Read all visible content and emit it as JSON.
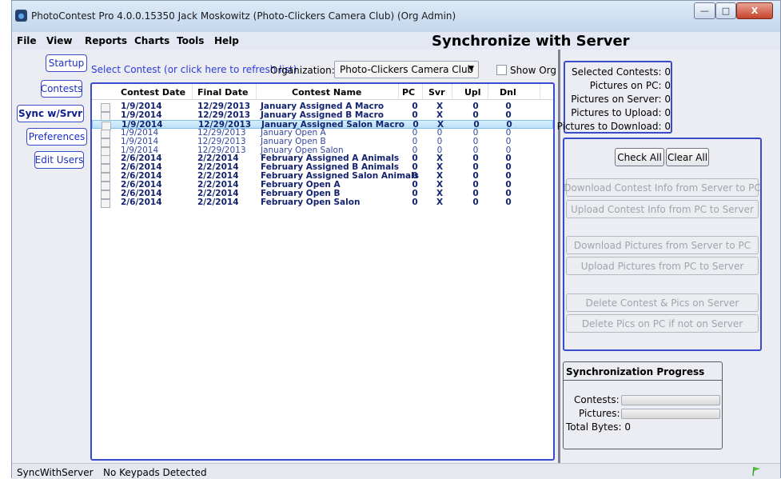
{
  "window": {
    "title": "PhotoContest Pro 4.0.0.15350 Jack Moskowitz (Photo-Clickers Camera Club) (Org Admin)",
    "controls": {
      "minimize": "—",
      "maximize": "□",
      "close": "X"
    }
  },
  "menu": [
    "File",
    "View",
    "Reports",
    "Charts",
    "Tools",
    "Help"
  ],
  "screen_title": "Synchronize with Server",
  "sidebar": [
    {
      "label": "Startup",
      "active": false
    },
    {
      "label": "Contests",
      "active": false
    },
    {
      "label": "Sync w/Srvr",
      "active": true
    },
    {
      "label": "Preferences",
      "active": false
    },
    {
      "label": "Edit Users",
      "active": false
    }
  ],
  "toolbar": {
    "select_link": "Select Contest (or click here to refresh list)",
    "org_label": "Organization:",
    "org_value": "Photo-Clickers Camera Club",
    "show_org_label": "Show Org"
  },
  "table": {
    "columns": [
      "Contest Date",
      "Final Date",
      "Contest Name",
      "PC",
      "Svr",
      "Upl",
      "Dnl"
    ],
    "rows": [
      {
        "date": "1/9/2014",
        "final": "12/29/2013",
        "name": "January Assigned A Macro",
        "pc": "0",
        "svr": "X",
        "upl": "0",
        "dnl": "0",
        "bold": true,
        "selected": false
      },
      {
        "date": "1/9/2014",
        "final": "12/29/2013",
        "name": "January Assigned B Macro",
        "pc": "0",
        "svr": "X",
        "upl": "0",
        "dnl": "0",
        "bold": true,
        "selected": false
      },
      {
        "date": "1/9/2014",
        "final": "12/29/2013",
        "name": "January Assigned Salon Macro",
        "pc": "0",
        "svr": "X",
        "upl": "0",
        "dnl": "0",
        "bold": true,
        "selected": true
      },
      {
        "date": "1/9/2014",
        "final": "12/29/2013",
        "name": "January Open A",
        "pc": "0",
        "svr": "0",
        "upl": "0",
        "dnl": "0",
        "bold": false,
        "selected": false
      },
      {
        "date": "1/9/2014",
        "final": "12/29/2013",
        "name": "January Open B",
        "pc": "0",
        "svr": "0",
        "upl": "0",
        "dnl": "0",
        "bold": false,
        "selected": false
      },
      {
        "date": "1/9/2014",
        "final": "12/29/2013",
        "name": "January Open Salon",
        "pc": "0",
        "svr": "0",
        "upl": "0",
        "dnl": "0",
        "bold": false,
        "selected": false
      },
      {
        "date": "2/6/2014",
        "final": "2/2/2014",
        "name": "February Assigned A Animals",
        "pc": "0",
        "svr": "X",
        "upl": "0",
        "dnl": "0",
        "bold": true,
        "selected": false
      },
      {
        "date": "2/6/2014",
        "final": "2/2/2014",
        "name": "February Assigned B Animals",
        "pc": "0",
        "svr": "X",
        "upl": "0",
        "dnl": "0",
        "bold": true,
        "selected": false
      },
      {
        "date": "2/6/2014",
        "final": "2/2/2014",
        "name": "February Assigned Salon Animals",
        "pc": "0",
        "svr": "X",
        "upl": "0",
        "dnl": "0",
        "bold": true,
        "selected": false
      },
      {
        "date": "2/6/2014",
        "final": "2/2/2014",
        "name": "February Open A",
        "pc": "0",
        "svr": "X",
        "upl": "0",
        "dnl": "0",
        "bold": true,
        "selected": false
      },
      {
        "date": "2/6/2014",
        "final": "2/2/2014",
        "name": "February Open B",
        "pc": "0",
        "svr": "X",
        "upl": "0",
        "dnl": "0",
        "bold": true,
        "selected": false
      },
      {
        "date": "2/6/2014",
        "final": "2/2/2014",
        "name": "February Open Salon",
        "pc": "0",
        "svr": "X",
        "upl": "0",
        "dnl": "0",
        "bold": true,
        "selected": false
      }
    ]
  },
  "stats": {
    "selected_contests": "Selected Contests: 0",
    "pictures_on_pc": "Pictures on PC: 0",
    "pictures_on_server": "Pictures on Server: 0",
    "pictures_to_upload": "Pictures to Upload: 0",
    "pictures_to_download": "Pictures to Download: 0"
  },
  "actions": {
    "check_all": "Check All",
    "clear_all": "Clear All",
    "download_contest_info": "Download Contest Info from Server to PC",
    "upload_contest_info": "Upload Contest Info from PC to Server",
    "download_pictures": "Download Pictures from Server to PC",
    "upload_pictures": "Upload Pictures from PC to Server",
    "delete_contest_pics": "Delete Contest & Pics on Server",
    "delete_pics_pc": "Delete Pics on PC if not on Server"
  },
  "progress": {
    "title": "Synchronization Progress",
    "contests_label": "Contests:",
    "pictures_label": "Pictures:",
    "total_bytes": "Total Bytes: 0",
    "contests_fraction": 0,
    "pictures_fraction": 0
  },
  "status": {
    "left": "SyncWithServer",
    "message": "No Keypads Detected",
    "flag_icon": "green-flag-icon"
  },
  "colors": {
    "accent_border": "#3a4ccc",
    "link": "#2a3bd8",
    "selected_row": "#b9e0f8"
  }
}
